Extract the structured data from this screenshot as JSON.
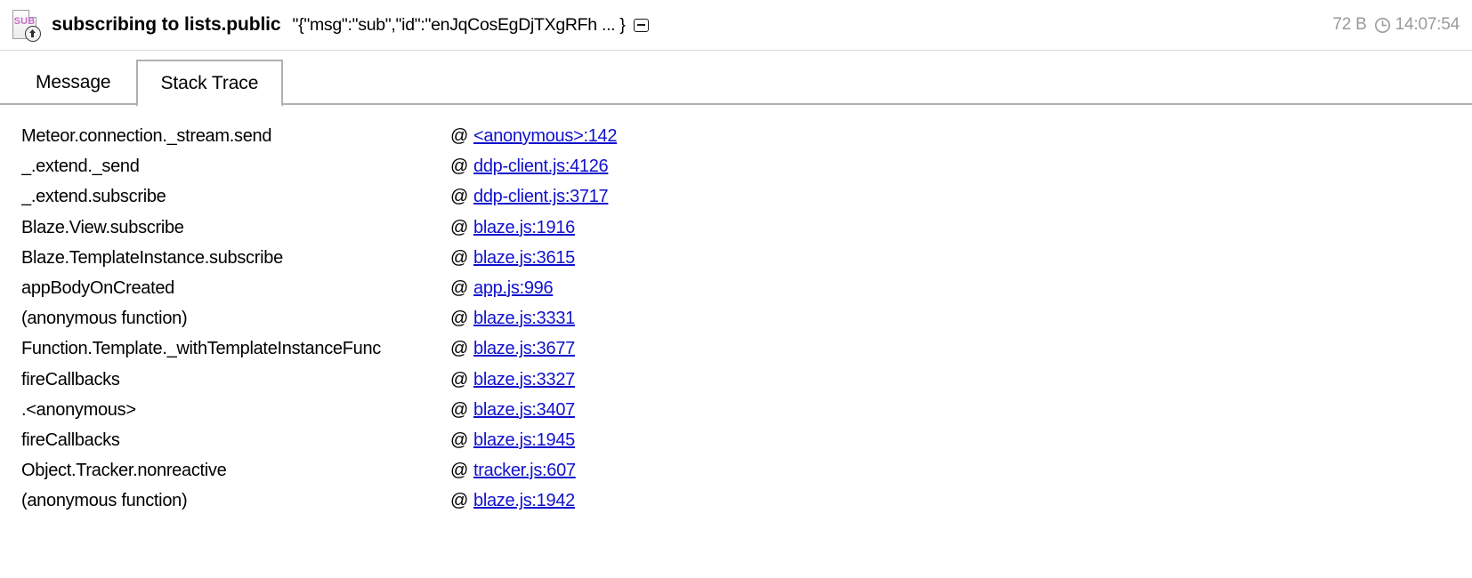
{
  "header": {
    "icon_name": "sub-message-icon",
    "icon_label": "SUB",
    "title": "subscribing to lists.public",
    "preview": "\"{\"msg\":\"sub\",\"id\":\"enJqCosEgDjTXgRFh ... }",
    "collapse_icon": "collapse-minus-icon",
    "size": "72 B",
    "clock_icon": "clock-icon",
    "time": "14:07:54"
  },
  "tabs": [
    {
      "label": "Message",
      "active": false
    },
    {
      "label": "Stack Trace",
      "active": true
    }
  ],
  "stack_trace": {
    "at_symbol": "@",
    "rows": [
      {
        "fn": "Meteor.connection._stream.send",
        "loc": "<anonymous>:142"
      },
      {
        "fn": "_.extend._send",
        "loc": "ddp-client.js:4126"
      },
      {
        "fn": "_.extend.subscribe",
        "loc": "ddp-client.js:3717"
      },
      {
        "fn": "Blaze.View.subscribe",
        "loc": "blaze.js:1916"
      },
      {
        "fn": "Blaze.TemplateInstance.subscribe",
        "loc": "blaze.js:3615"
      },
      {
        "fn": "appBodyOnCreated",
        "loc": "app.js:996"
      },
      {
        "fn": "(anonymous function)",
        "loc": "blaze.js:3331"
      },
      {
        "fn": "Function.Template._withTemplateInstanceFunc",
        "loc": "blaze.js:3677"
      },
      {
        "fn": "fireCallbacks",
        "loc": "blaze.js:3327"
      },
      {
        "fn": ".<anonymous>",
        "loc": "blaze.js:3407"
      },
      {
        "fn": "fireCallbacks",
        "loc": "blaze.js:1945"
      },
      {
        "fn": "Object.Tracker.nonreactive",
        "loc": "tracker.js:607"
      },
      {
        "fn": "(anonymous function)",
        "loc": "blaze.js:1942"
      }
    ]
  },
  "colors": {
    "link": "#1111cc",
    "icon_accent": "#c46fc4",
    "meta_text": "#9a9a9a",
    "border": "#b0b0b0"
  }
}
